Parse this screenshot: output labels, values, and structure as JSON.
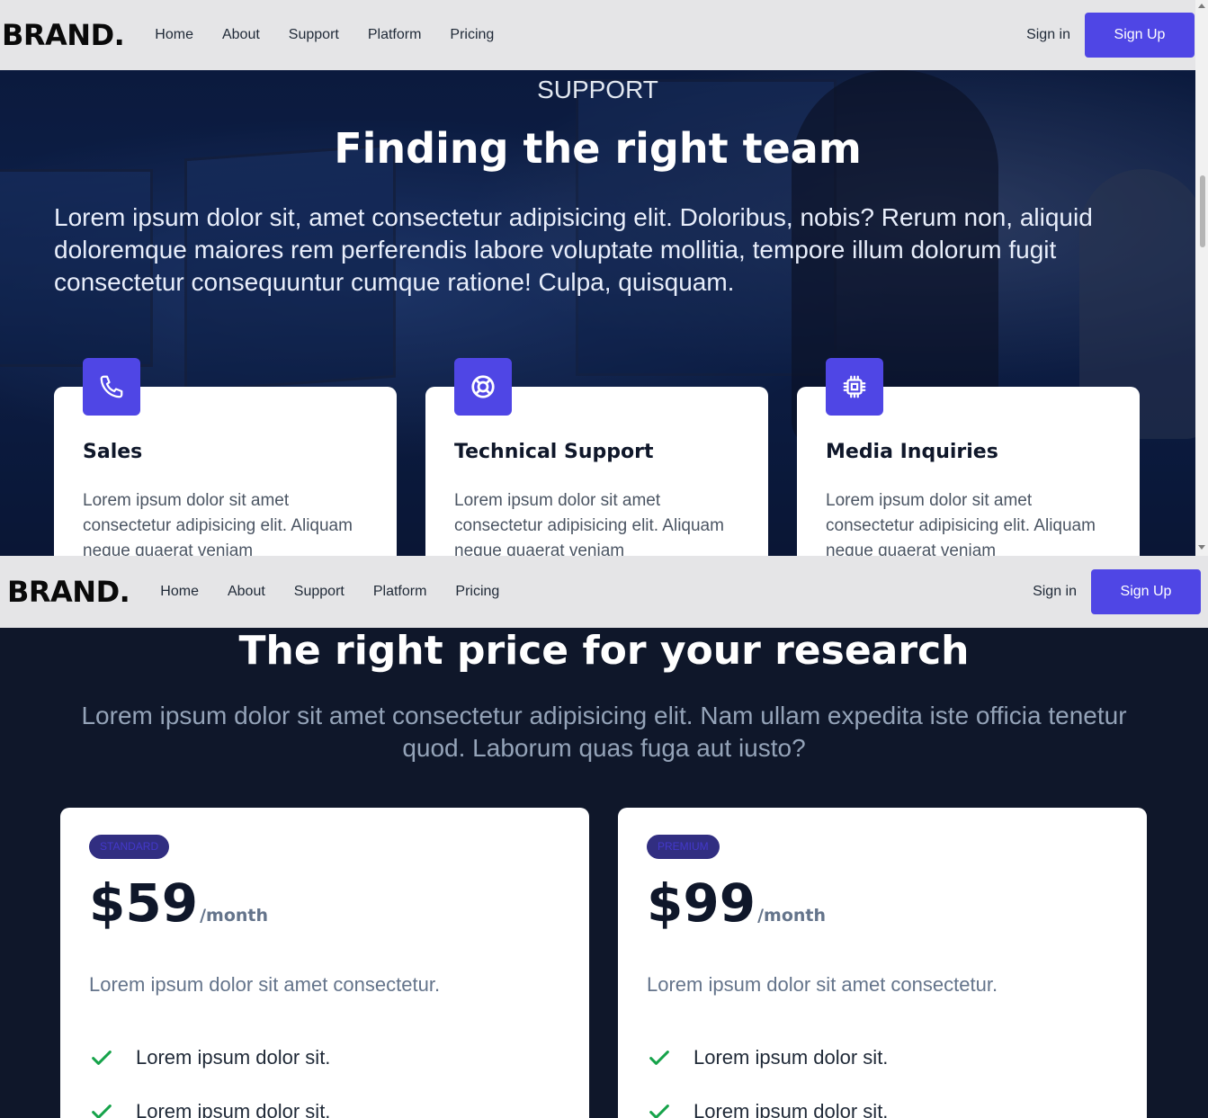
{
  "navbar": {
    "brand": "BRAND.",
    "links": [
      "Home",
      "About",
      "Support",
      "Platform",
      "Pricing"
    ],
    "sign_in": "Sign in",
    "sign_up": "Sign Up"
  },
  "hero": {
    "kicker": "SUPPORT",
    "title": "Finding the right team",
    "text": "Lorem ipsum dolor sit, amet consectetur adipisicing elit. Doloribus, nobis? Rerum non, aliquid doloremque maiores rem perferendis labore voluptate mollitia, tempore illum dolorum fugit consectetur consequuntur cumque ratione! Culpa, quisquam.",
    "cards": [
      {
        "icon": "phone-icon",
        "title": "Sales",
        "text": "Lorem ipsum dolor sit amet consectetur adipisicing elit. Aliquam neque quaerat veniam"
      },
      {
        "icon": "lifebuoy-icon",
        "title": "Technical Support",
        "text": "Lorem ipsum dolor sit amet consectetur adipisicing elit. Aliquam neque quaerat veniam"
      },
      {
        "icon": "chip-icon",
        "title": "Media Inquiries",
        "text": "Lorem ipsum dolor sit amet consectetur adipisicing elit. Aliquam neque quaerat veniam"
      }
    ]
  },
  "pricing": {
    "title": "The right price for your research",
    "subtitle": "Lorem ipsum dolor sit amet consectetur adipisicing elit. Nam ullam expedita iste officia tenetur quod. Laborum quas fuga aut iusto?",
    "plans": [
      {
        "tier": "STANDARD",
        "price": "$59",
        "period": "/month",
        "description": "Lorem ipsum dolor sit amet consectetur.",
        "features": [
          "Lorem ipsum dolor sit.",
          "Lorem ipsum dolor sit."
        ]
      },
      {
        "tier": "PREMIUM",
        "price": "$99",
        "period": "/month",
        "description": "Lorem ipsum dolor sit amet consectetur.",
        "features": [
          "Lorem ipsum dolor sit.",
          "Lorem ipsum dolor sit."
        ]
      }
    ]
  },
  "colors": {
    "accent": "#4f46e5",
    "dark_bg": "#0f172a",
    "check": "#16a34a"
  }
}
